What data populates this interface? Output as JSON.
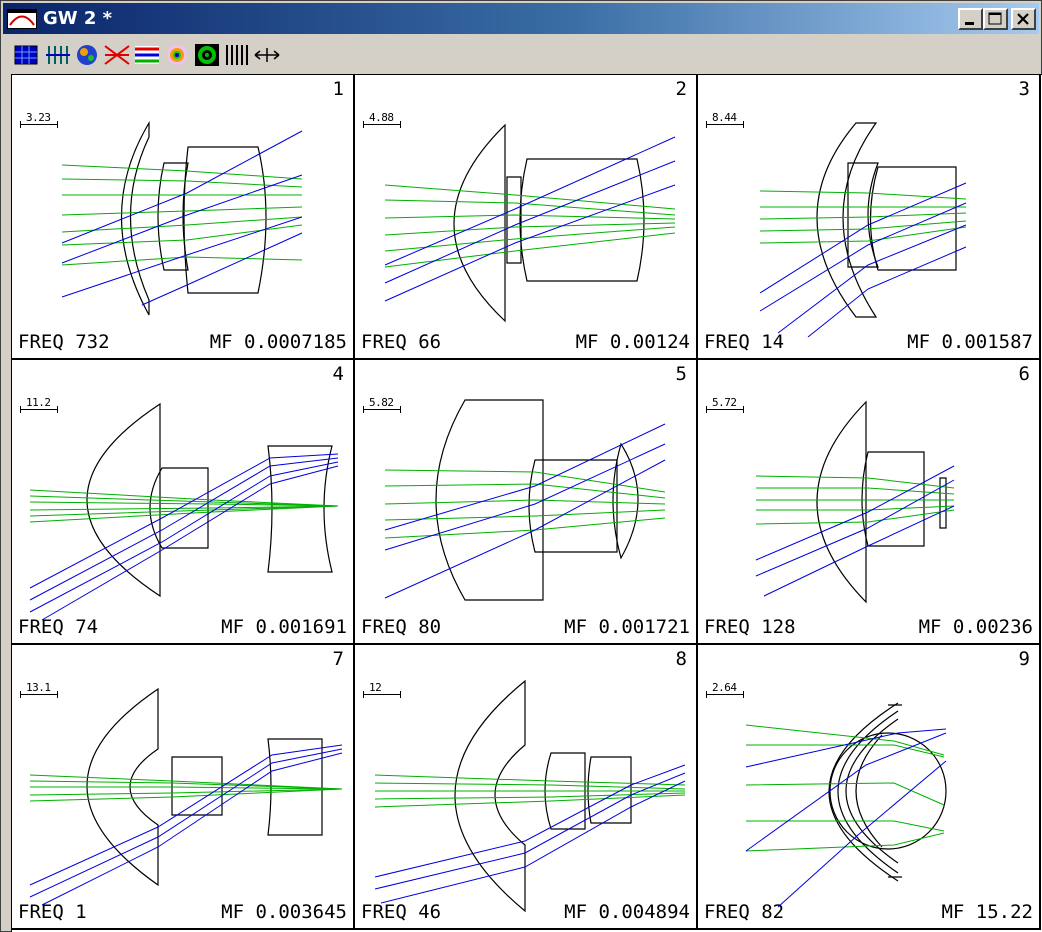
{
  "window": {
    "title": "GW 2 *",
    "title_color": "#ffffff",
    "titlebar_color": "#0a246a",
    "controls": [
      "minimize-icon",
      "maximize-icon",
      "close-icon"
    ]
  },
  "toolbar": {
    "icons": [
      "layout-icon",
      "tolerance-icon",
      "color-sphere-icon",
      "ray-fan-icon",
      "spot-diagram-icon",
      "psf-icon",
      "mtf-target-icon",
      "grid-lines-icon",
      "move-arrows-icon"
    ]
  },
  "colors": {
    "ray_axial": "#00b000",
    "ray_offaxis": "#0000ff",
    "lens": "#000000"
  },
  "panels": [
    {
      "number": "1",
      "scale": "3.23",
      "freq": "FREQ 732",
      "mf": "MF 0.0007185"
    },
    {
      "number": "2",
      "scale": "4.88",
      "freq": "FREQ 66",
      "mf": "MF 0.00124"
    },
    {
      "number": "3",
      "scale": "8.44",
      "freq": "FREQ 14",
      "mf": "MF 0.001587"
    },
    {
      "number": "4",
      "scale": "11.2",
      "freq": "FREQ 74",
      "mf": "MF 0.001691"
    },
    {
      "number": "5",
      "scale": "5.82",
      "freq": "FREQ 80",
      "mf": "MF 0.001721"
    },
    {
      "number": "6",
      "scale": "5.72",
      "freq": "FREQ 128",
      "mf": "MF 0.00236"
    },
    {
      "number": "7",
      "scale": "13.1",
      "freq": "FREQ 1",
      "mf": "MF 0.003645"
    },
    {
      "number": "8",
      "scale": "12",
      "freq": "FREQ 46",
      "mf": "MF 0.004894"
    },
    {
      "number": "9",
      "scale": "2.64",
      "freq": "FREQ 82",
      "mf": "MF 15.22"
    }
  ]
}
